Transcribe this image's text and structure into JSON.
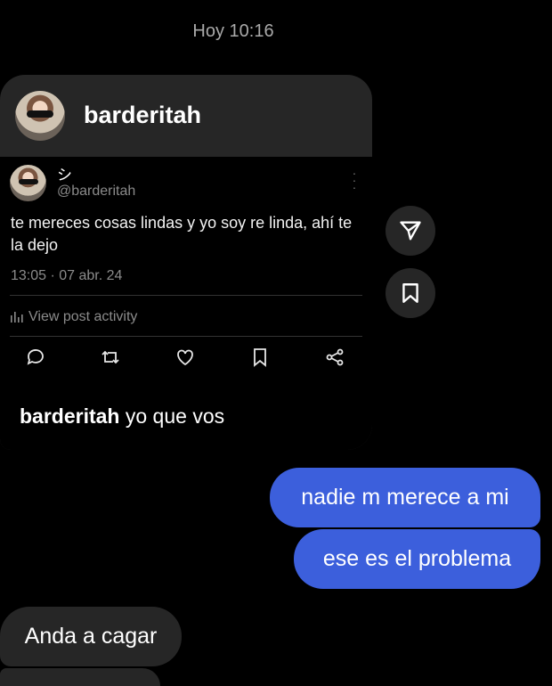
{
  "timestamp": "Hoy 10:16",
  "shared_post": {
    "sender_name": "barderitah",
    "author_display": "シ",
    "author_handle": "@barderitah",
    "text": "te mereces cosas lindas y yo soy re linda, ahí te la dejo",
    "time": "13:05 · 07 abr. 24",
    "activity_label": "View post activity",
    "actions": [
      "reply-icon",
      "repost-icon",
      "like-icon",
      "bookmark-icon",
      "share-icon"
    ],
    "caption_user": "barderitah",
    "caption_text": " yo que vos"
  },
  "side_actions": [
    "send-icon",
    "bookmark-icon"
  ],
  "messages": [
    {
      "direction": "out",
      "text": "nadie m merece a mi"
    },
    {
      "direction": "out",
      "text": "ese es el problema"
    },
    {
      "direction": "in",
      "text": "Anda a cagar"
    }
  ],
  "colors": {
    "background": "#000000",
    "incoming_bubble": "#262626",
    "outgoing_bubble": "#3c5fdc",
    "muted_text": "#8b8b8b"
  }
}
